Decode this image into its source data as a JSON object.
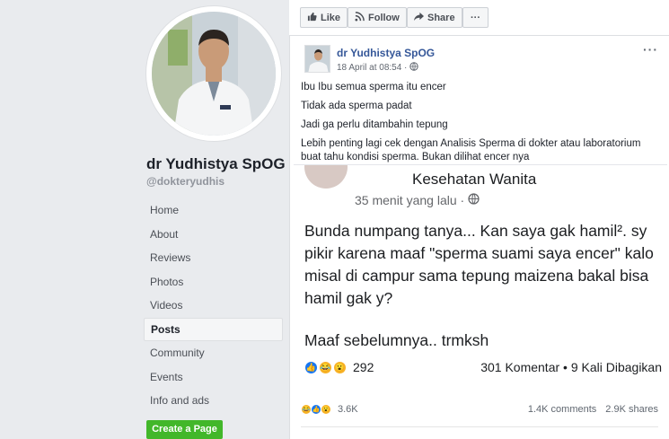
{
  "page": {
    "name": "dr Yudhistya SpOG",
    "handle": "@dokteryudhis"
  },
  "nav": {
    "items": [
      "Home",
      "About",
      "Reviews",
      "Photos",
      "Videos",
      "Posts",
      "Community",
      "Events",
      "Info and ads"
    ],
    "active": "Posts",
    "create_page": "Create a Page"
  },
  "actions": {
    "like": "Like",
    "follow": "Follow",
    "share": "Share",
    "more": "···"
  },
  "post": {
    "author": "dr Yudhistya SpOG",
    "timestamp": "18 April at 08:54 ·",
    "menu": "···",
    "lines": [
      "Ibu Ibu semua sperma itu encer",
      "Tidak ada sperma padat",
      "Jadi ga perlu ditambahin tepung",
      "Lebih penting lagi cek dengan Analisis Sperma di dokter atau laboratorium buat tahu kondisi sperma. Bukan dilihat encer nya"
    ],
    "embedded": {
      "group": "Kesehatan Wanita",
      "time": "35 menit yang lalu ·",
      "question": "Bunda numpang tanya... Kan saya gak hamil². sy pikir karena maaf \"sperma suami saya encer\" kalo misal di campur sama tepung maizena bakal bisa hamil gak y?",
      "closing": "Maaf sebelumnya.. trmksh",
      "reaction_count": "292",
      "comments_shares": "301 Komentar • 9 Kali Dibagikan"
    },
    "reactions": "3.6K",
    "comments": "1.4K comments",
    "shares": "2.9K shares"
  }
}
